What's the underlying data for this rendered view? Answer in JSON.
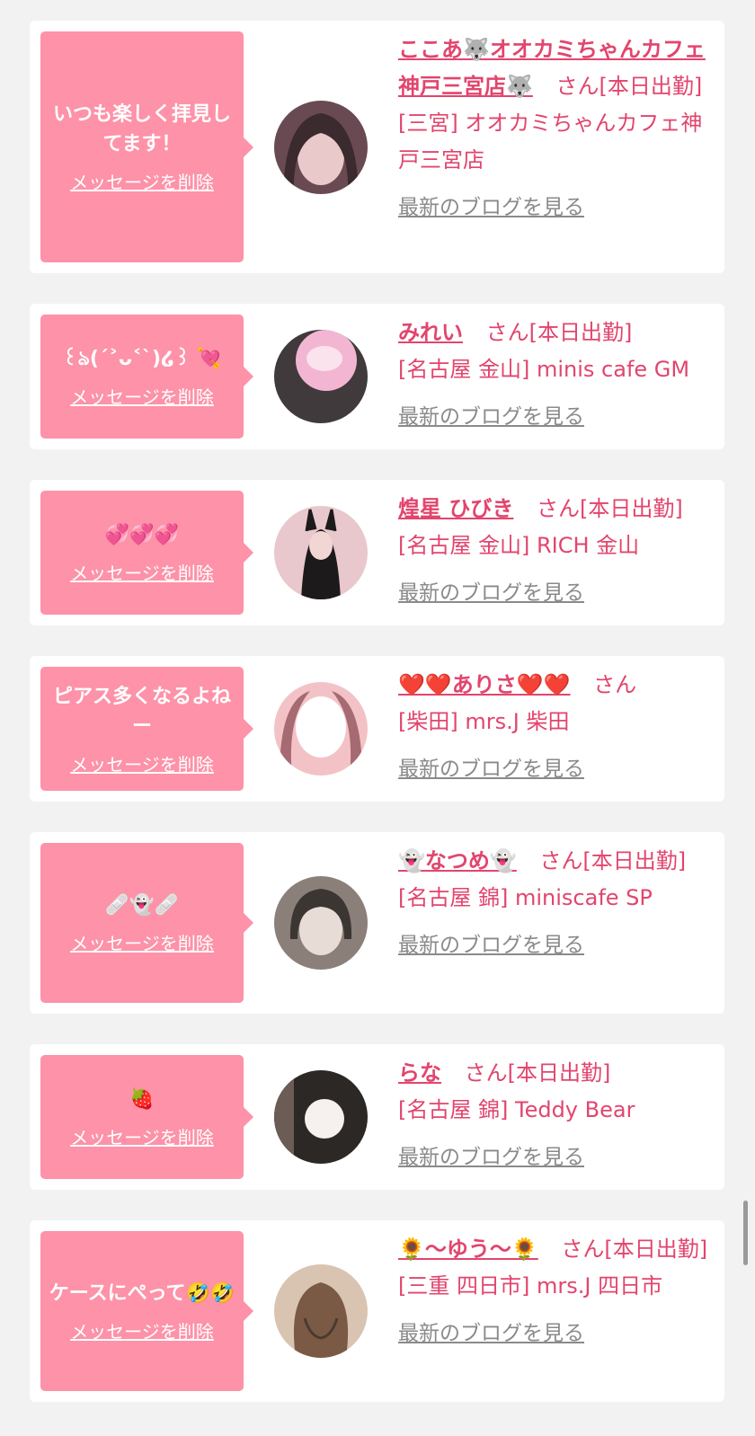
{
  "cards": [
    {
      "message": "いつも楽しく拝見してます！",
      "delete_label": "メッセージを削除",
      "name": "ここあ🐺オオカミちゃんカフェ神戸三宮店🐺",
      "suffix": "さん[本日出勤]",
      "shop": "[三宮] オオカミちゃんカフェ神戸三宮店",
      "blog_label": "最新のブログを見る",
      "avatar_colors": [
        "#6a4a52",
        "#e9c9c9",
        "#3b2a2e"
      ]
    },
    {
      "message": "꒰ঌ(ˊ˃ᴗ˂ˋ)໒꒱ 💘",
      "delete_label": "メッセージを削除",
      "name": "みれい",
      "suffix": "さん[本日出勤]",
      "shop": "[名古屋 金山] minis cafe GM",
      "blog_label": "最新のブログを見る",
      "avatar_colors": [
        "#f3b6d2",
        "#fbe3ee",
        "#403a3c"
      ]
    },
    {
      "message": "💞💞💞",
      "delete_label": "メッセージを削除",
      "name": "煌星 ひびき",
      "suffix": "さん[本日出勤]",
      "shop": "[名古屋 金山] RICH 金山",
      "blog_label": "最新のブログを見る",
      "avatar_colors": [
        "#e8c7cd",
        "#1d1a1c",
        "#c46b7b"
      ]
    },
    {
      "message": "ピアス多くなるよねー",
      "delete_label": "メッセージを削除",
      "name": "❤️❤️ありさ❤️❤️",
      "suffix": "さん",
      "shop": "[柴田] mrs.J 柴田",
      "blog_label": "最新のブログを見る",
      "avatar_colors": [
        "#f3c2c6",
        "#ffffff",
        "#a66a72"
      ]
    },
    {
      "message": "🩹👻🩹",
      "delete_label": "メッセージを削除",
      "name": "👻なつめ👻",
      "suffix": "さん[本日出勤]",
      "shop": "[名古屋 錦] miniscafe SP",
      "blog_label": "最新のブログを見る",
      "avatar_colors": [
        "#8a8079",
        "#e7ddd6",
        "#3c3633"
      ]
    },
    {
      "message": "🍓",
      "delete_label": "メッセージを削除",
      "name": "らな",
      "suffix": "さん[本日出勤]",
      "shop": "[名古屋 錦] Teddy Bear",
      "blog_label": "最新のブログを見る",
      "avatar_colors": [
        "#2c2826",
        "#f6f0ee",
        "#6b5c55"
      ]
    },
    {
      "message": "ケースにぺって🤣🤣",
      "delete_label": "メッセージを削除",
      "name": "🌻〜ゆう〜🌻",
      "suffix": "さん[本日出勤]",
      "shop": "[三重 四日市] mrs.J 四日市",
      "blog_label": "最新のブログを見る",
      "avatar_colors": [
        "#7a5a44",
        "#d9c4b2",
        "#4a3a30"
      ]
    }
  ]
}
